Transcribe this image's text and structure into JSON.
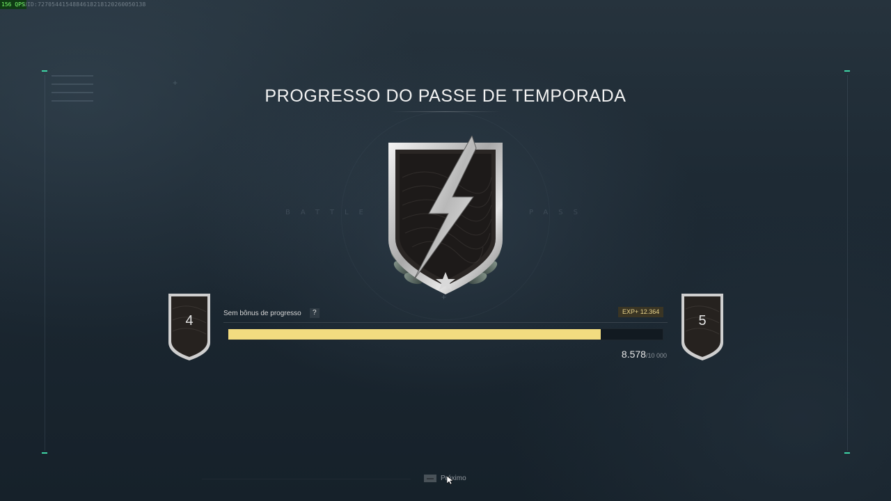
{
  "overlay": {
    "fps": "156 QPS",
    "uid": "UID:7270544154884618218120260050138"
  },
  "title": "PROGRESSO DO PASSE DE TEMPORADA",
  "background_words": {
    "left": "BATTLE",
    "right": "PASS"
  },
  "emblem": {
    "icon": "lightning-bolt-shield-icon"
  },
  "tiers": {
    "current": "4",
    "next": "5"
  },
  "progress": {
    "bonus_label": "Sem bônus de progresso",
    "help_label": "?",
    "exp_badge": "EXP+ 12.364",
    "current": "8.578",
    "max": "/10 000",
    "fraction": 0.8578
  },
  "footer": {
    "next_label": "Próximo",
    "key_icon": "keyboard-key-icon"
  },
  "colors": {
    "accent_corner": "#3fd6a6",
    "bar_fill": "#f3dc80",
    "exp_badge_text": "#e9d48b"
  }
}
